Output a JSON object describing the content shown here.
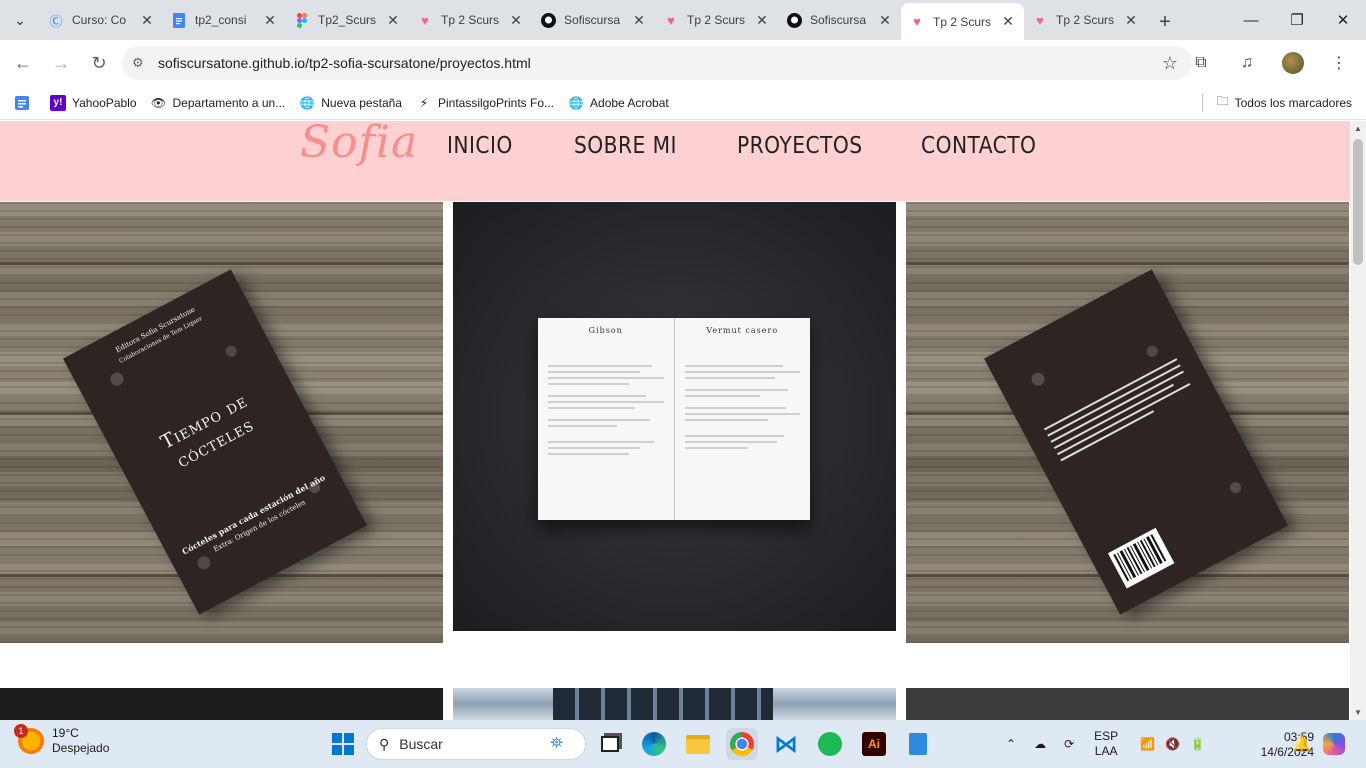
{
  "browser": {
    "tabs": [
      {
        "title": "Curso: Co",
        "icon": "course-icon",
        "active": false
      },
      {
        "title": "tp2_consi",
        "icon": "docs-icon",
        "active": false
      },
      {
        "title": "Tp2_Scurs",
        "icon": "figma-icon",
        "active": false
      },
      {
        "title": "Tp 2 Scurs",
        "icon": "heart-icon",
        "active": false
      },
      {
        "title": "Sofiscursa",
        "icon": "github-icon",
        "active": false
      },
      {
        "title": "Tp 2 Scurs",
        "icon": "heart-icon",
        "active": false
      },
      {
        "title": "Sofiscursa",
        "icon": "github-icon",
        "active": false
      },
      {
        "title": "Tp 2 Scurs",
        "icon": "heart-icon",
        "active": true
      },
      {
        "title": "Tp 2 Scurs",
        "icon": "heart-icon",
        "active": false
      }
    ],
    "url": "sofiscursatone.github.io/tp2-sofia-scursatone/proyectos.html",
    "bookmarks": [
      {
        "label": "",
        "icon": "apps-icon"
      },
      {
        "label": "YahooPablo",
        "icon": "yahoo-icon"
      },
      {
        "label": "Departamento a un...",
        "icon": "eye-icon"
      },
      {
        "label": "Nueva pestaña",
        "icon": "globe-icon"
      },
      {
        "label": "PintassilgoPrints Fo...",
        "icon": "bolt-icon"
      },
      {
        "label": "Adobe Acrobat",
        "icon": "globe-icon"
      }
    ],
    "all_bookmarks": "Todos los marcadores"
  },
  "site": {
    "logo": "Sofia",
    "nav": [
      "INICIO",
      "SOBRE MI",
      "PROYECTOS",
      "CONTACTO"
    ],
    "colors": {
      "header_bg": "#fdd0d2",
      "logo": "#f48f8c"
    },
    "projects": [
      {
        "book_title": "Tiempo de cócteles",
        "subtitle": "Cócteles para cada estación del año",
        "extra": "Extra: Origen de los cócteles",
        "publisher": "Editora Sofia Scursatone",
        "collab": "Colaboraciones de Tem Liquor"
      },
      {
        "page_left_title": "Gibson",
        "page_right_title": "Vermut casero"
      },
      {
        "back_cover": true
      }
    ]
  },
  "taskbar": {
    "weather_temp": "19°C",
    "weather_desc": "Despejado",
    "weather_badge": "1",
    "search_placeholder": "Buscar",
    "lang_top": "ESP",
    "lang_bottom": "LAA",
    "time": "03:59",
    "date": "14/6/2024"
  }
}
